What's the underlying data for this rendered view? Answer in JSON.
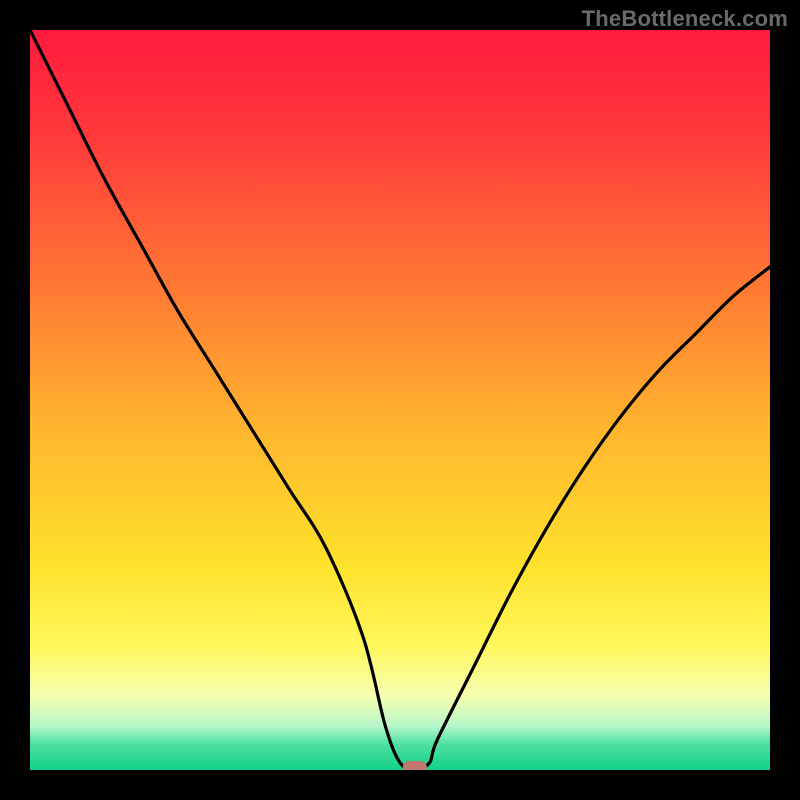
{
  "watermark": "TheBottleneck.com",
  "chart_data": {
    "type": "line",
    "title": "",
    "xlabel": "",
    "ylabel": "",
    "xlim": [
      0,
      100
    ],
    "ylim": [
      0,
      100
    ],
    "x": [
      0,
      5,
      10,
      15,
      20,
      25,
      30,
      35,
      40,
      45,
      48,
      50,
      52,
      54,
      55,
      60,
      65,
      70,
      75,
      80,
      85,
      90,
      95,
      100
    ],
    "values": [
      100,
      90,
      80,
      71,
      62,
      54,
      46,
      38,
      30,
      18,
      6,
      1,
      0,
      1,
      4,
      14,
      24,
      33,
      41,
      48,
      54,
      59,
      64,
      68
    ],
    "series": [
      {
        "name": "bottleneck-curve",
        "x": [
          0,
          5,
          10,
          15,
          20,
          25,
          30,
          35,
          40,
          45,
          48,
          50,
          52,
          54,
          55,
          60,
          65,
          70,
          75,
          80,
          85,
          90,
          95,
          100
        ],
        "values": [
          100,
          90,
          80,
          71,
          62,
          54,
          46,
          38,
          30,
          18,
          6,
          1,
          0,
          1,
          4,
          14,
          24,
          33,
          41,
          48,
          54,
          59,
          64,
          68
        ]
      }
    ],
    "marker": {
      "x": 52,
      "y": 0,
      "color": "#c1786f"
    },
    "gradient_stops": [
      {
        "offset": 0.0,
        "color": "#ff1a3d"
      },
      {
        "offset": 0.15,
        "color": "#ff3b3b"
      },
      {
        "offset": 0.35,
        "color": "#ff7a33"
      },
      {
        "offset": 0.55,
        "color": "#ffb82e"
      },
      {
        "offset": 0.72,
        "color": "#ffe12b"
      },
      {
        "offset": 0.83,
        "color": "#fff75a"
      },
      {
        "offset": 0.9,
        "color": "#f6ffb0"
      },
      {
        "offset": 0.94,
        "color": "#b7f7c9"
      },
      {
        "offset": 0.965,
        "color": "#4fe0a0"
      },
      {
        "offset": 1.0,
        "color": "#12d18a"
      }
    ]
  }
}
